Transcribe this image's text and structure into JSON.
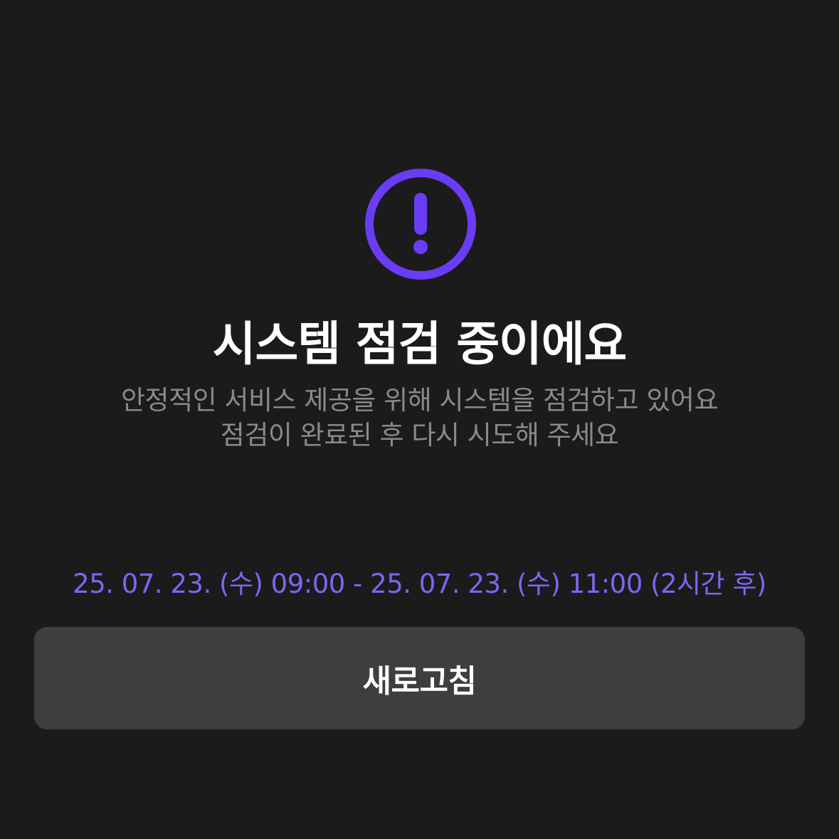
{
  "notice": {
    "icon": "exclamation-circle-icon",
    "accent_color": "#6b3cf5",
    "title": "시스템 점검 중이에요",
    "description_line1": "안정적인 서비스 제공을 위해 시스템을 점검하고 있어요",
    "description_line2": "점검이 완료된 후 다시 시도해 주세요",
    "schedule": "25. 07. 23. (수) 09:00 - 25. 07. 23. (수) 11:00 (2시간 후)",
    "schedule_color": "#7b67f0"
  },
  "actions": {
    "refresh_label": "새로고침"
  }
}
